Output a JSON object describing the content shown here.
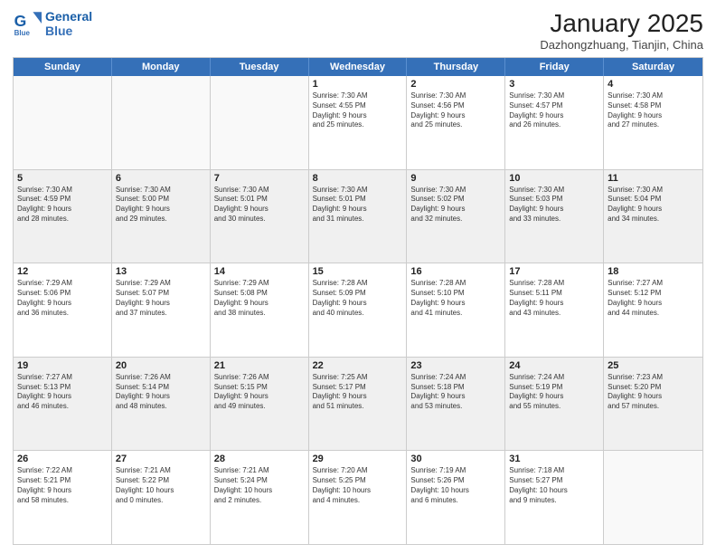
{
  "logo": {
    "line1": "General",
    "line2": "Blue"
  },
  "title": "January 2025",
  "subtitle": "Dazhongzhuang, Tianjin, China",
  "header_days": [
    "Sunday",
    "Monday",
    "Tuesday",
    "Wednesday",
    "Thursday",
    "Friday",
    "Saturday"
  ],
  "weeks": [
    [
      {
        "day": "",
        "info": "",
        "shaded": false,
        "empty": true
      },
      {
        "day": "",
        "info": "",
        "shaded": false,
        "empty": true
      },
      {
        "day": "",
        "info": "",
        "shaded": false,
        "empty": true
      },
      {
        "day": "1",
        "info": "Sunrise: 7:30 AM\nSunset: 4:55 PM\nDaylight: 9 hours\nand 25 minutes.",
        "shaded": false,
        "empty": false
      },
      {
        "day": "2",
        "info": "Sunrise: 7:30 AM\nSunset: 4:56 PM\nDaylight: 9 hours\nand 25 minutes.",
        "shaded": false,
        "empty": false
      },
      {
        "day": "3",
        "info": "Sunrise: 7:30 AM\nSunset: 4:57 PM\nDaylight: 9 hours\nand 26 minutes.",
        "shaded": false,
        "empty": false
      },
      {
        "day": "4",
        "info": "Sunrise: 7:30 AM\nSunset: 4:58 PM\nDaylight: 9 hours\nand 27 minutes.",
        "shaded": false,
        "empty": false
      }
    ],
    [
      {
        "day": "5",
        "info": "Sunrise: 7:30 AM\nSunset: 4:59 PM\nDaylight: 9 hours\nand 28 minutes.",
        "shaded": true,
        "empty": false
      },
      {
        "day": "6",
        "info": "Sunrise: 7:30 AM\nSunset: 5:00 PM\nDaylight: 9 hours\nand 29 minutes.",
        "shaded": true,
        "empty": false
      },
      {
        "day": "7",
        "info": "Sunrise: 7:30 AM\nSunset: 5:01 PM\nDaylight: 9 hours\nand 30 minutes.",
        "shaded": true,
        "empty": false
      },
      {
        "day": "8",
        "info": "Sunrise: 7:30 AM\nSunset: 5:01 PM\nDaylight: 9 hours\nand 31 minutes.",
        "shaded": true,
        "empty": false
      },
      {
        "day": "9",
        "info": "Sunrise: 7:30 AM\nSunset: 5:02 PM\nDaylight: 9 hours\nand 32 minutes.",
        "shaded": true,
        "empty": false
      },
      {
        "day": "10",
        "info": "Sunrise: 7:30 AM\nSunset: 5:03 PM\nDaylight: 9 hours\nand 33 minutes.",
        "shaded": true,
        "empty": false
      },
      {
        "day": "11",
        "info": "Sunrise: 7:30 AM\nSunset: 5:04 PM\nDaylight: 9 hours\nand 34 minutes.",
        "shaded": true,
        "empty": false
      }
    ],
    [
      {
        "day": "12",
        "info": "Sunrise: 7:29 AM\nSunset: 5:06 PM\nDaylight: 9 hours\nand 36 minutes.",
        "shaded": false,
        "empty": false
      },
      {
        "day": "13",
        "info": "Sunrise: 7:29 AM\nSunset: 5:07 PM\nDaylight: 9 hours\nand 37 minutes.",
        "shaded": false,
        "empty": false
      },
      {
        "day": "14",
        "info": "Sunrise: 7:29 AM\nSunset: 5:08 PM\nDaylight: 9 hours\nand 38 minutes.",
        "shaded": false,
        "empty": false
      },
      {
        "day": "15",
        "info": "Sunrise: 7:28 AM\nSunset: 5:09 PM\nDaylight: 9 hours\nand 40 minutes.",
        "shaded": false,
        "empty": false
      },
      {
        "day": "16",
        "info": "Sunrise: 7:28 AM\nSunset: 5:10 PM\nDaylight: 9 hours\nand 41 minutes.",
        "shaded": false,
        "empty": false
      },
      {
        "day": "17",
        "info": "Sunrise: 7:28 AM\nSunset: 5:11 PM\nDaylight: 9 hours\nand 43 minutes.",
        "shaded": false,
        "empty": false
      },
      {
        "day": "18",
        "info": "Sunrise: 7:27 AM\nSunset: 5:12 PM\nDaylight: 9 hours\nand 44 minutes.",
        "shaded": false,
        "empty": false
      }
    ],
    [
      {
        "day": "19",
        "info": "Sunrise: 7:27 AM\nSunset: 5:13 PM\nDaylight: 9 hours\nand 46 minutes.",
        "shaded": true,
        "empty": false
      },
      {
        "day": "20",
        "info": "Sunrise: 7:26 AM\nSunset: 5:14 PM\nDaylight: 9 hours\nand 48 minutes.",
        "shaded": true,
        "empty": false
      },
      {
        "day": "21",
        "info": "Sunrise: 7:26 AM\nSunset: 5:15 PM\nDaylight: 9 hours\nand 49 minutes.",
        "shaded": true,
        "empty": false
      },
      {
        "day": "22",
        "info": "Sunrise: 7:25 AM\nSunset: 5:17 PM\nDaylight: 9 hours\nand 51 minutes.",
        "shaded": true,
        "empty": false
      },
      {
        "day": "23",
        "info": "Sunrise: 7:24 AM\nSunset: 5:18 PM\nDaylight: 9 hours\nand 53 minutes.",
        "shaded": true,
        "empty": false
      },
      {
        "day": "24",
        "info": "Sunrise: 7:24 AM\nSunset: 5:19 PM\nDaylight: 9 hours\nand 55 minutes.",
        "shaded": true,
        "empty": false
      },
      {
        "day": "25",
        "info": "Sunrise: 7:23 AM\nSunset: 5:20 PM\nDaylight: 9 hours\nand 57 minutes.",
        "shaded": true,
        "empty": false
      }
    ],
    [
      {
        "day": "26",
        "info": "Sunrise: 7:22 AM\nSunset: 5:21 PM\nDaylight: 9 hours\nand 58 minutes.",
        "shaded": false,
        "empty": false
      },
      {
        "day": "27",
        "info": "Sunrise: 7:21 AM\nSunset: 5:22 PM\nDaylight: 10 hours\nand 0 minutes.",
        "shaded": false,
        "empty": false
      },
      {
        "day": "28",
        "info": "Sunrise: 7:21 AM\nSunset: 5:24 PM\nDaylight: 10 hours\nand 2 minutes.",
        "shaded": false,
        "empty": false
      },
      {
        "day": "29",
        "info": "Sunrise: 7:20 AM\nSunset: 5:25 PM\nDaylight: 10 hours\nand 4 minutes.",
        "shaded": false,
        "empty": false
      },
      {
        "day": "30",
        "info": "Sunrise: 7:19 AM\nSunset: 5:26 PM\nDaylight: 10 hours\nand 6 minutes.",
        "shaded": false,
        "empty": false
      },
      {
        "day": "31",
        "info": "Sunrise: 7:18 AM\nSunset: 5:27 PM\nDaylight: 10 hours\nand 9 minutes.",
        "shaded": false,
        "empty": false
      },
      {
        "day": "",
        "info": "",
        "shaded": false,
        "empty": true
      }
    ]
  ]
}
